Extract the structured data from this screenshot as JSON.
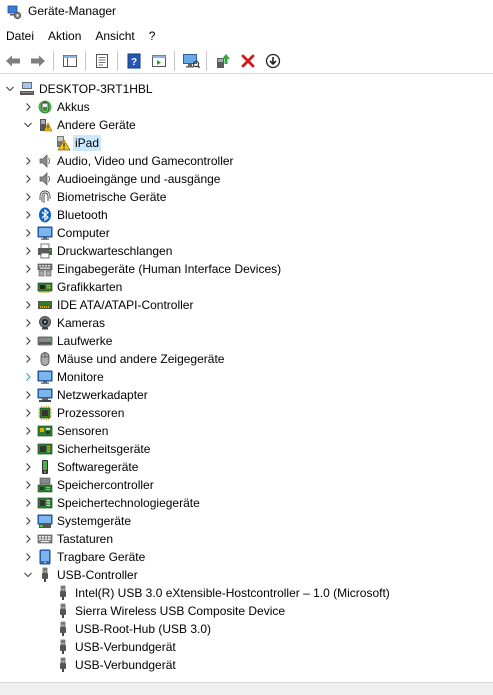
{
  "window": {
    "title": "Geräte-Manager"
  },
  "menu": {
    "items": [
      "Datei",
      "Aktion",
      "Ansicht",
      "?"
    ]
  },
  "colors": {
    "selection": "#cce8ff",
    "chevron": "#404040",
    "chevron_highlight": "#2a9fd6",
    "delete_red": "#d4151b"
  },
  "tree": {
    "root": "DESKTOP-3RT1HBL",
    "nodes": [
      {
        "label": "Akkus",
        "icon": "battery-icon"
      },
      {
        "label": "Andere Geräte",
        "icon": "unknown-device-icon",
        "expanded": true,
        "children": [
          {
            "label": "iPad",
            "icon": "warning-device-icon",
            "selected": true
          }
        ]
      },
      {
        "label": "Audio, Video und Gamecontroller",
        "icon": "speaker-icon"
      },
      {
        "label": "Audioeingänge und -ausgänge",
        "icon": "speaker-icon"
      },
      {
        "label": "Biometrische Geräte",
        "icon": "fingerprint-icon"
      },
      {
        "label": "Bluetooth",
        "icon": "bluetooth-icon"
      },
      {
        "label": "Computer",
        "icon": "monitor-icon"
      },
      {
        "label": "Druckwarteschlangen",
        "icon": "printer-icon"
      },
      {
        "label": "Eingabegeräte (Human Interface Devices)",
        "icon": "keyboard-hid-icon"
      },
      {
        "label": "Grafikkarten",
        "icon": "display-adapter-icon"
      },
      {
        "label": "IDE ATA/ATAPI-Controller",
        "icon": "ide-controller-icon"
      },
      {
        "label": "Kameras",
        "icon": "camera-icon"
      },
      {
        "label": "Laufwerke",
        "icon": "drive-icon"
      },
      {
        "label": "Mäuse und andere Zeigegeräte",
        "icon": "mouse-icon"
      },
      {
        "label": "Monitore",
        "icon": "monitor-icon",
        "highlight_chevron": true
      },
      {
        "label": "Netzwerkadapter",
        "icon": "network-adapter-icon"
      },
      {
        "label": "Prozessoren",
        "icon": "processor-icon"
      },
      {
        "label": "Sensoren",
        "icon": "sensor-icon"
      },
      {
        "label": "Sicherheitsgeräte",
        "icon": "security-device-icon"
      },
      {
        "label": "Softwaregeräte",
        "icon": "software-device-icon"
      },
      {
        "label": "Speichercontroller",
        "icon": "storage-controller-icon"
      },
      {
        "label": "Speichertechnologiegeräte",
        "icon": "storage-tech-icon"
      },
      {
        "label": "Systemgeräte",
        "icon": "system-device-icon"
      },
      {
        "label": "Tastaturen",
        "icon": "keyboard-icon"
      },
      {
        "label": "Tragbare Geräte",
        "icon": "portable-device-icon"
      },
      {
        "label": "USB-Controller",
        "icon": "usb-icon",
        "expanded": true,
        "children": [
          {
            "label": "Intel(R) USB 3.0 eXtensible-Hostcontroller – 1.0 (Microsoft)",
            "icon": "usb-plug-icon"
          },
          {
            "label": "Sierra Wireless USB Composite Device",
            "icon": "usb-plug-icon"
          },
          {
            "label": "USB-Root-Hub (USB 3.0)",
            "icon": "usb-plug-icon"
          },
          {
            "label": "USB-Verbundgerät",
            "icon": "usb-plug-icon"
          },
          {
            "label": "USB-Verbundgerät",
            "icon": "usb-plug-icon"
          }
        ]
      }
    ]
  }
}
